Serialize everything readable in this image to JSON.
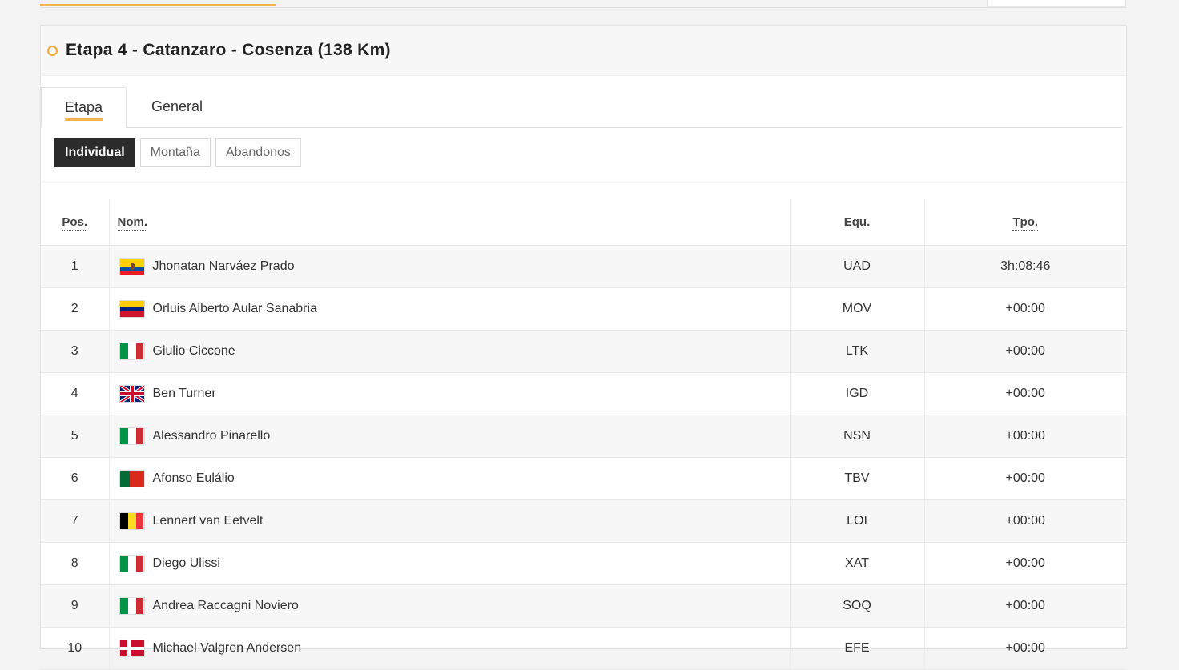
{
  "stage_title": "Etapa 4 - Catanzaro - Cosenza (138 Km)",
  "tabs": [
    {
      "label": "Etapa",
      "active": true
    },
    {
      "label": "General",
      "active": false
    }
  ],
  "subtabs": [
    {
      "label": "Individual",
      "active": true
    },
    {
      "label": "Montaña",
      "active": false
    },
    {
      "label": "Abandonos",
      "active": false
    }
  ],
  "table": {
    "headers": {
      "pos": "Pos.",
      "nom": "Nom.",
      "equ": "Equ.",
      "tpo": "Tpo."
    },
    "rows": [
      {
        "pos": "1",
        "flag": "ecuador-flag",
        "name": "Jhonatan Narváez Prado",
        "team": "UAD",
        "time": "3h:08:46"
      },
      {
        "pos": "2",
        "flag": "venezuela-flag",
        "name": "Orluis Alberto Aular Sanabria",
        "team": "MOV",
        "time": "+00:00"
      },
      {
        "pos": "3",
        "flag": "italy-flag",
        "name": "Giulio Ciccone",
        "team": "LTK",
        "time": "+00:00"
      },
      {
        "pos": "4",
        "flag": "uk-flag",
        "name": "Ben Turner",
        "team": "IGD",
        "time": "+00:00"
      },
      {
        "pos": "5",
        "flag": "italy-flag",
        "name": "Alessandro Pinarello",
        "team": "NSN",
        "time": "+00:00"
      },
      {
        "pos": "6",
        "flag": "portugal-flag",
        "name": "Afonso Eulálio",
        "team": "TBV",
        "time": "+00:00"
      },
      {
        "pos": "7",
        "flag": "belgium-flag",
        "name": "Lennert van Eetvelt",
        "team": "LOI",
        "time": "+00:00"
      },
      {
        "pos": "8",
        "flag": "italy-flag",
        "name": "Diego Ulissi",
        "team": "XAT",
        "time": "+00:00"
      },
      {
        "pos": "9",
        "flag": "italy-flag",
        "name": "Andrea Raccagni Noviero",
        "team": "SOQ",
        "time": "+00:00"
      },
      {
        "pos": "10",
        "flag": "denmark-flag",
        "name": "Michael Valgren Andersen",
        "team": "EFE",
        "time": "+00:00"
      }
    ]
  },
  "colors": {
    "accent": "#f0b54d",
    "active_subtab": "#2b2b2b"
  }
}
